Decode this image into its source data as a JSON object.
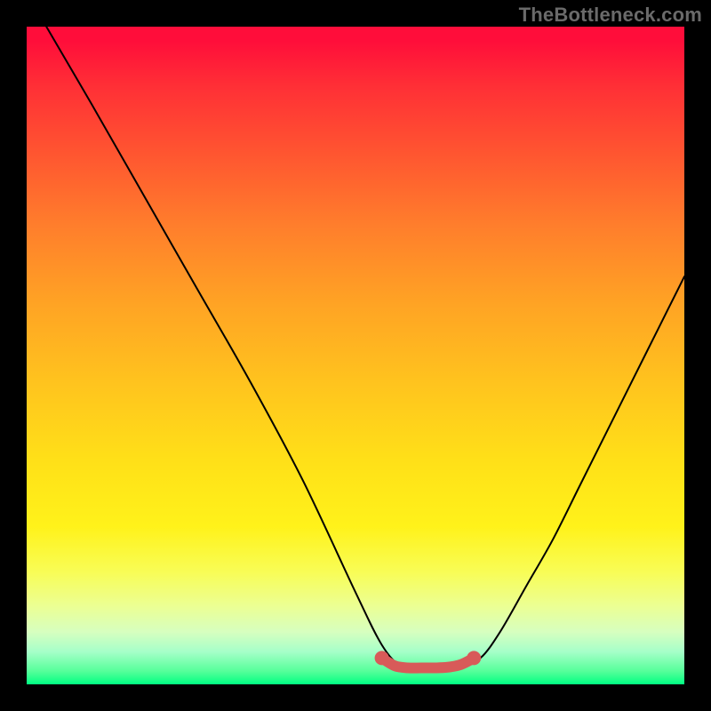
{
  "watermark": "TheBottleneck.com",
  "chart_data": {
    "type": "line",
    "title": "",
    "xlabel": "",
    "ylabel": "",
    "xlim": [
      0,
      100
    ],
    "ylim": [
      0,
      100
    ],
    "grid": false,
    "series": [
      {
        "name": "curve",
        "color": "#000000",
        "x": [
          3,
          10,
          18,
          26,
          34,
          42,
          50,
          54,
          57,
          60,
          63,
          66,
          69,
          72,
          76,
          80,
          84,
          88,
          92,
          96,
          100
        ],
        "y": [
          100,
          88,
          74,
          60,
          46,
          31,
          14,
          6,
          2.7,
          2.5,
          2.5,
          2.7,
          4,
          8,
          15,
          22,
          30,
          38,
          46,
          54,
          62
        ]
      },
      {
        "name": "trough-highlight",
        "color": "#d85a59",
        "x": [
          54,
          56,
          58,
          60,
          62,
          64,
          66,
          68
        ],
        "y": [
          4,
          2.8,
          2.5,
          2.5,
          2.5,
          2.6,
          3,
          4
        ]
      }
    ],
    "gradient_stops": [
      {
        "pos": 0,
        "color": "#ff0d3a"
      },
      {
        "pos": 50,
        "color": "#ffc31e"
      },
      {
        "pos": 82,
        "color": "#f8fd57"
      },
      {
        "pos": 100,
        "color": "#00ff82"
      }
    ]
  }
}
